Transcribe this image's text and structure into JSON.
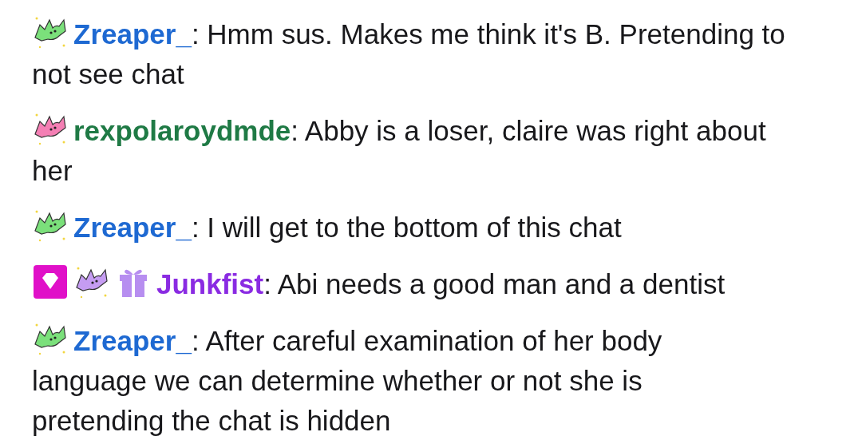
{
  "messages": [
    {
      "badges": [
        {
          "kind": "bat",
          "color": "#7be07b"
        }
      ],
      "user": "Zreaper_",
      "color": "#1e69d2",
      "lines": [
        ": Hmm sus. Makes me think it's B. Pretending to",
        "not see chat"
      ]
    },
    {
      "badges": [
        {
          "kind": "bat",
          "color": "#f47fb4"
        }
      ],
      "user": "rexpolaroydmde",
      "color": "#1f7a45",
      "lines": [
        ": Abby is a loser, claire was right about",
        "her"
      ]
    },
    {
      "badges": [
        {
          "kind": "bat",
          "color": "#7be07b"
        }
      ],
      "user": "Zreaper_",
      "color": "#1e69d2",
      "lines": [
        ": I will get to the bottom of this chat"
      ]
    },
    {
      "badges": [
        {
          "kind": "diamond",
          "color": "#e010c8"
        },
        {
          "kind": "bat",
          "color": "#c59cf2"
        },
        {
          "kind": "gift",
          "color": "#b78ef0"
        }
      ],
      "user": "Junkfist",
      "color": "#8a2be2",
      "lines": [
        ": Abi needs a good man and a dentist"
      ]
    },
    {
      "badges": [
        {
          "kind": "bat",
          "color": "#7be07b"
        }
      ],
      "user": "Zreaper_",
      "color": "#1e69d2",
      "lines": [
        ": After careful examination of her body",
        "language we can determine whether or not she is",
        "pretending the chat is hidden"
      ]
    }
  ]
}
